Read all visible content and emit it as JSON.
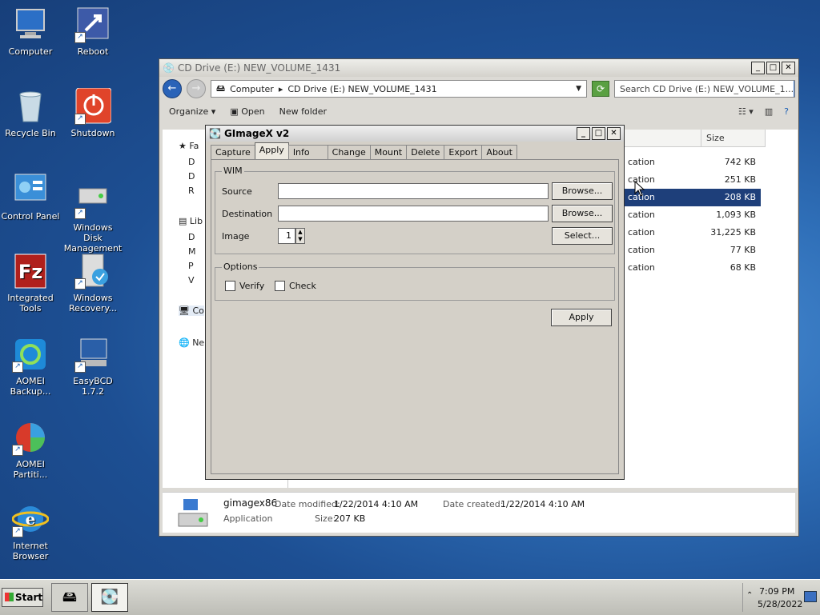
{
  "desktop": {
    "icons": [
      {
        "label": "Computer",
        "icon": "computer-icon"
      },
      {
        "label": "Reboot",
        "icon": "reboot-icon"
      },
      {
        "label": "Recycle Bin",
        "icon": "recycle-bin-icon"
      },
      {
        "label": "Shutdown",
        "icon": "shutdown-icon"
      },
      {
        "label": "Control Panel",
        "icon": "control-panel-icon"
      },
      {
        "label": "Windows Disk Management",
        "icon": "disk-management-icon"
      },
      {
        "label": "Integrated Tools",
        "icon": "filezilla-icon"
      },
      {
        "label": "Windows Recovery...",
        "icon": "windows-recovery-icon"
      },
      {
        "label": "AOMEI Backup...",
        "icon": "aomei-backup-icon"
      },
      {
        "label": "EasyBCD 1.7.2",
        "icon": "easybcd-icon"
      },
      {
        "label": "AOMEI Partiti...",
        "icon": "aomei-partition-icon"
      },
      {
        "label": "Internet Browser",
        "icon": "internet-explorer-icon"
      }
    ]
  },
  "explorer": {
    "title": "CD Drive (E:) NEW_VOLUME_1431",
    "address": [
      "Computer",
      "CD Drive (E:) NEW_VOLUME_1431"
    ],
    "search_placeholder": "Search CD Drive (E:) NEW_VOLUME_1...",
    "toolbar": {
      "organize": "Organize",
      "open": "Open",
      "new_folder": "New folder"
    },
    "nav": [
      "Fa",
      "D",
      "D",
      "R",
      "Lib",
      "D",
      "M",
      "P",
      "V",
      "Co",
      "Ne"
    ],
    "columns": {
      "size": "Size"
    },
    "files": [
      {
        "type": "cation",
        "size": "742 KB",
        "selected": false
      },
      {
        "type": "cation",
        "size": "251 KB",
        "selected": false
      },
      {
        "type": "cation",
        "size": "208 KB",
        "selected": true
      },
      {
        "type": "cation",
        "size": "1,093 KB",
        "selected": false
      },
      {
        "type": "cation",
        "size": "31,225 KB",
        "selected": false
      },
      {
        "type": "cation",
        "size": "77 KB",
        "selected": false
      },
      {
        "type": "cation",
        "size": "68 KB",
        "selected": false
      }
    ],
    "details": {
      "name": "gimagex86",
      "date_modified_label": "Date modified:",
      "date_modified": "1/22/2014 4:10 AM",
      "date_created_label": "Date created:",
      "date_created": "1/22/2014 4:10 AM",
      "type": "Application",
      "size_label": "Size:",
      "size": "207 KB"
    }
  },
  "gimagex": {
    "title": "GImageX v2",
    "tabs": [
      "Capture",
      "Apply",
      "Info",
      "Change",
      "Mount",
      "Delete",
      "Export",
      "About"
    ],
    "active_tab": "Apply",
    "wim_group": "WIM",
    "source_label": "Source",
    "source_value": "",
    "destination_label": "Destination",
    "destination_value": "",
    "image_label": "Image",
    "image_value": "1",
    "browse_label": "Browse...",
    "select_label": "Select...",
    "options_group": "Options",
    "verify_label": "Verify",
    "check_label": "Check",
    "apply_button": "Apply"
  },
  "taskbar": {
    "start": "Start",
    "time": "7:09 PM",
    "date": "5/28/2022"
  }
}
